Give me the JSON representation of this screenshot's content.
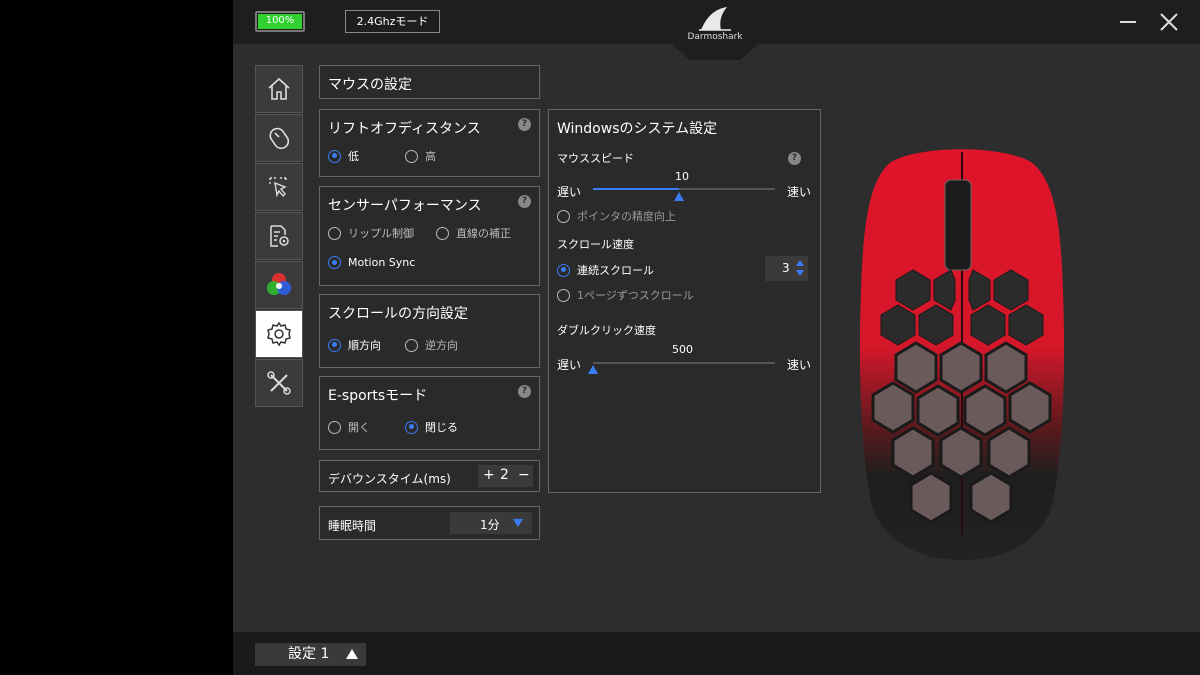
{
  "titlebar": {
    "battery_label": "100%",
    "battery_level": 1.0,
    "connection_mode": "2.4Ghzモード",
    "brand": "Darmoshark"
  },
  "sidebar": {
    "items": [
      {
        "name": "home",
        "icon": "home-icon"
      },
      {
        "name": "mouse",
        "icon": "mouse-icon"
      },
      {
        "name": "macro",
        "icon": "cursor-select-icon"
      },
      {
        "name": "settings-doc",
        "icon": "document-gear-icon"
      },
      {
        "name": "lighting",
        "icon": "rgb-circles-icon"
      },
      {
        "name": "settings",
        "icon": "gear-icon",
        "active": true
      },
      {
        "name": "tools",
        "icon": "wrench-screwdriver-icon"
      }
    ]
  },
  "mouse_settings": {
    "title": "マウスの設定"
  },
  "lift_off": {
    "title": "リフトオフディスタンス",
    "options": [
      "低",
      "高"
    ],
    "selected": "低"
  },
  "sensor": {
    "title": "センサーパフォーマンス",
    "options": [
      "リップル制御",
      "直線の補正",
      "Motion Sync"
    ],
    "selected": "Motion Sync"
  },
  "scroll_dir": {
    "title": "スクロールの方向設定",
    "options": [
      "順方向",
      "逆方向"
    ],
    "selected": "順方向"
  },
  "esports": {
    "title": "E-sportsモード",
    "options": [
      "開く",
      "閉じる"
    ],
    "selected": "閉じる"
  },
  "debounce": {
    "label": "デバウンスタイム(ms)",
    "plus": "+",
    "value": "2",
    "minus": "−"
  },
  "sleep": {
    "label": "睡眠時間",
    "value": "1分"
  },
  "windows": {
    "title": "Windowsのシステム設定",
    "mouse_speed": {
      "label": "マウススピード",
      "value": "10",
      "level": 0.47,
      "slow": "遅い",
      "fast": "速い"
    },
    "pointer_precision": "ポインタの精度向上",
    "scroll_speed": {
      "label": "スクロール速度",
      "continuous": "連続スクロール",
      "continuous_value": "3",
      "page": "1ページずつスクロール"
    },
    "double_click": {
      "label": "ダブルクリック速度",
      "value": "500",
      "level": 0.0,
      "slow": "遅い",
      "fast": "速い"
    }
  },
  "bottom": {
    "profile": "設定 1"
  },
  "colors": {
    "accent": "#3a7cf5",
    "battery": "#2fd12f",
    "mouse_red": "#d9182a"
  }
}
